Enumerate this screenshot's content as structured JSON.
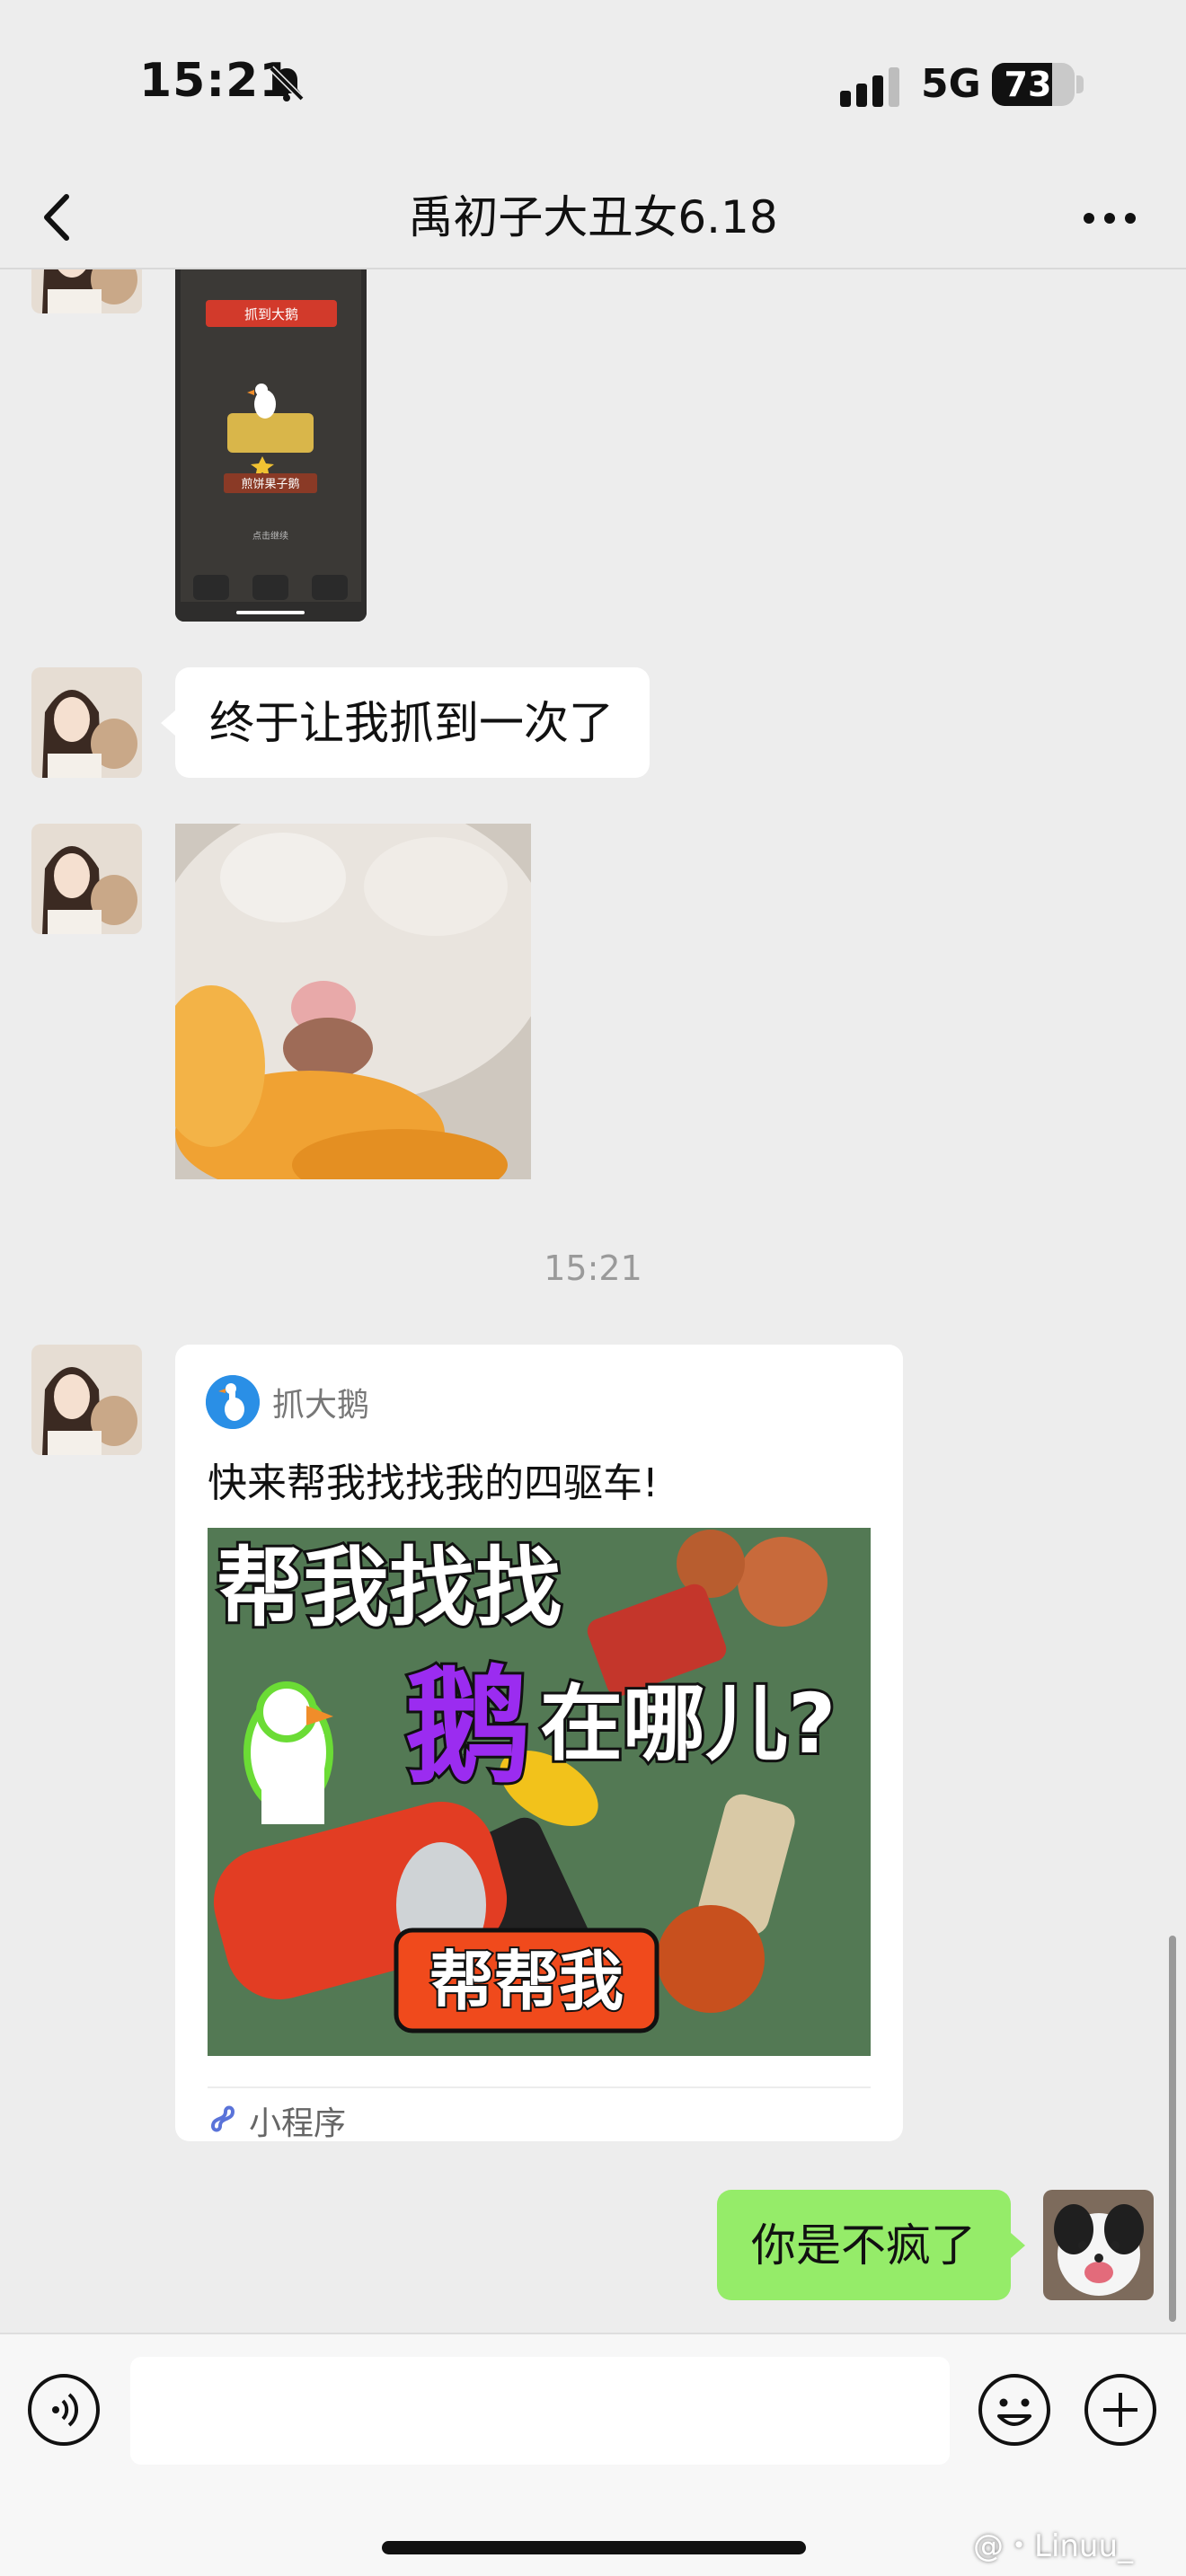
{
  "status_bar": {
    "time": "15:21",
    "network": "5G",
    "battery": "73",
    "battery_level_percent": 73
  },
  "nav": {
    "title": "禹初子大丑女6.18",
    "back_icon": "chevron-left-icon",
    "more_icon": "more-dots-icon"
  },
  "messages": {
    "text1": "终于让我抓到一次了",
    "timestamp": "15:21",
    "mini_program": {
      "app_name": "抓大鹅",
      "description": "快来帮我找找我的四驱车!",
      "label": "小程序",
      "thumb_text_line1": "帮我找找",
      "thumb_text_goose": "鹅",
      "thumb_text_where": "在哪儿?",
      "thumb_button": "帮帮我"
    },
    "my_text": "你是不疯了",
    "game_card": {
      "banner": "抓到大鹅",
      "name": "煎饼果子鹅",
      "hint": "点击继续"
    }
  },
  "input_bar": {
    "placeholder": "",
    "voice_icon": "voice-icon",
    "emoji_icon": "emoji-icon",
    "plus_icon": "plus-icon"
  },
  "watermark": "@・Linuu_",
  "colors": {
    "background": "#ededed",
    "my_bubble": "#95ec69",
    "their_bubble": "#ffffff"
  }
}
